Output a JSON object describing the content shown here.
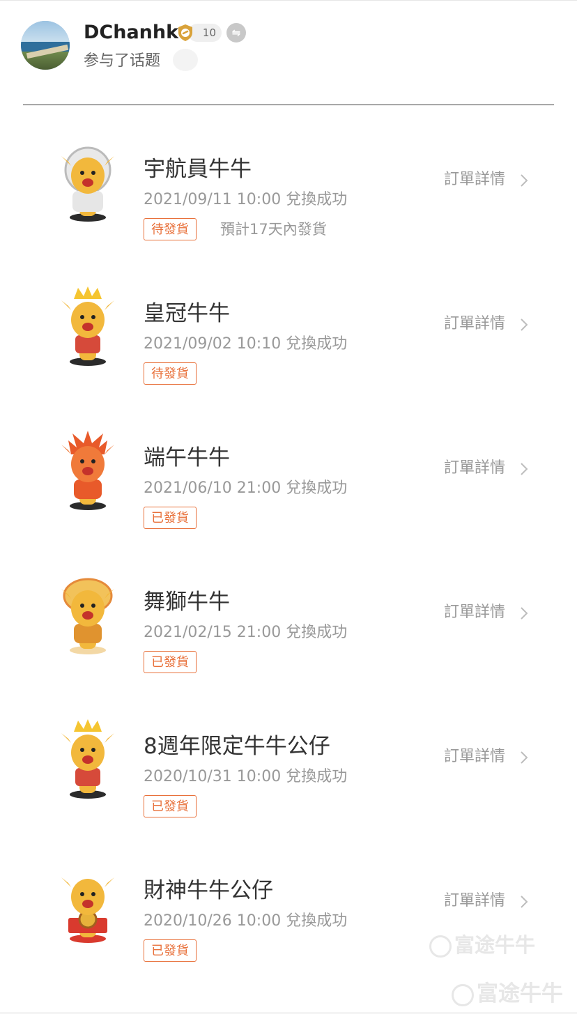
{
  "header": {
    "username": "DChanhk",
    "level": "10",
    "subtitle": "参与了话题"
  },
  "orders": [
    {
      "name": "宇航員牛牛",
      "date": "2021/09/11 10:00",
      "exchange": "兌換成功",
      "status": "待發貨",
      "eta": "預計17天內發貨",
      "detail": "訂單詳情",
      "figure": "astronaut-bull"
    },
    {
      "name": "皇冠牛牛",
      "date": "2021/09/02 10:10",
      "exchange": "兌換成功",
      "status": "待發貨",
      "eta": "",
      "detail": "訂單詳情",
      "figure": "crown-bull"
    },
    {
      "name": "端午牛牛",
      "date": "2021/06/10 21:00",
      "exchange": "兌換成功",
      "status": "已發貨",
      "eta": "",
      "detail": "訂單詳情",
      "figure": "dragon-bull"
    },
    {
      "name": "舞獅牛牛",
      "date": "2021/02/15 21:00",
      "exchange": "兌換成功",
      "status": "已發貨",
      "eta": "",
      "detail": "訂單詳情",
      "figure": "lion-dance-bull"
    },
    {
      "name": "8週年限定牛牛公仔",
      "date": "2020/10/31 10:00",
      "exchange": "兌換成功",
      "status": "已發貨",
      "eta": "",
      "detail": "訂單詳情",
      "figure": "crown-bull"
    },
    {
      "name": "財神牛牛公仔",
      "date": "2020/10/26 10:00",
      "exchange": "兌換成功",
      "status": "已發貨",
      "eta": "",
      "detail": "訂單詳情",
      "figure": "fortune-bull"
    }
  ],
  "watermark": "富途牛牛",
  "colors": {
    "status": "#e8703a",
    "figure": "#f2b83c",
    "muted": "#999999"
  }
}
